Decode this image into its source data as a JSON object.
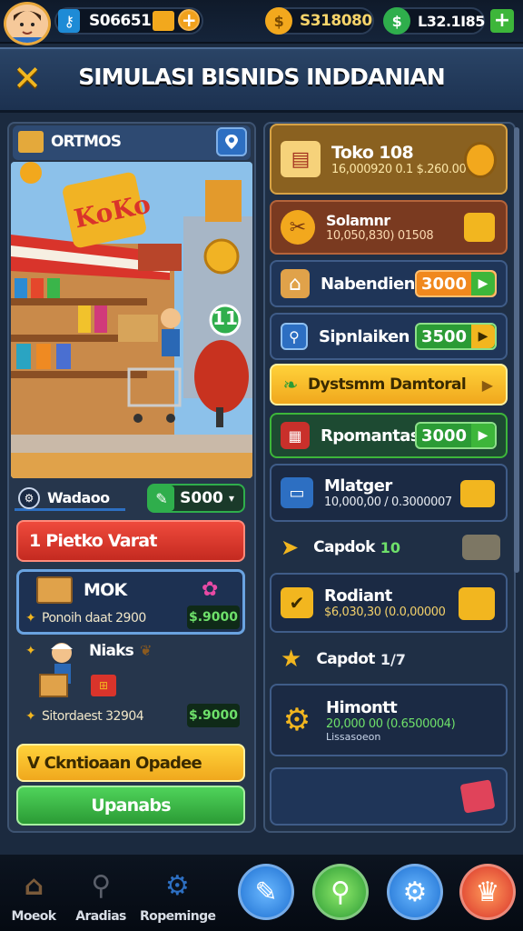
{
  "topbar": {
    "id_value": "S06651",
    "gold_value": "S318080",
    "cash_value": "L32.1I85",
    "cash_suffix": "S",
    "plus": "+",
    "coin_glyph": "$",
    "cash_glyph": "$"
  },
  "header": {
    "close_glyph": "✕",
    "title": "SIMULASI BISNIDS INDDANIAN"
  },
  "store_panel": {
    "header_label": "ORTMOS",
    "sign_text": "KoKo",
    "badge_text": "11",
    "bar_label": "Wadaoo",
    "bar_value": "S000",
    "red_button": "1 Pietko Varat",
    "item1": {
      "name": "MOK",
      "line": "Ponoih daat 2900",
      "price": "$.9000"
    },
    "item2": {
      "name": "Niaks",
      "line": "Sitordaest 32904",
      "price": "$.9000"
    },
    "yellow_button": "V Ckntioaan Opadee",
    "green_button": "Upanabs"
  },
  "right_panel": {
    "rows": [
      {
        "label": "Toko 108",
        "sub": "16,000920 0.1 $.260.00"
      },
      {
        "label": "Solamnr",
        "sub": "10,050,830) 01508"
      },
      {
        "label": "Nabendien",
        "value": "3000"
      },
      {
        "label": "Sipnlaiken",
        "value": "3500"
      },
      {
        "label": "Dystsmm Damtoral"
      },
      {
        "label": "Rpomantasl",
        "value": "3000"
      },
      {
        "label": "Mlatger",
        "sub": "10,000,00 / 0.3000007"
      },
      {
        "label": "Capdok",
        "value_green": "10"
      },
      {
        "label": "Rodiant",
        "sub": "$6,030,30 (0.0,00000"
      },
      {
        "label": "Capdot",
        "value_plain": "1/7"
      },
      {
        "label": "Himontt",
        "sub": "20,000 00 (0.6500004)",
        "sub2": "Lissasoeon"
      }
    ]
  },
  "bottom_nav": {
    "items": [
      {
        "label": "Moeok"
      },
      {
        "label": "Aradias"
      },
      {
        "label": "Ropeminge"
      }
    ]
  },
  "colors": {
    "accent_gold": "#f2a81d",
    "accent_green": "#3db63a",
    "accent_red": "#d9302b",
    "panel_bg": "#26364c",
    "row_bg": "#1f3558"
  }
}
